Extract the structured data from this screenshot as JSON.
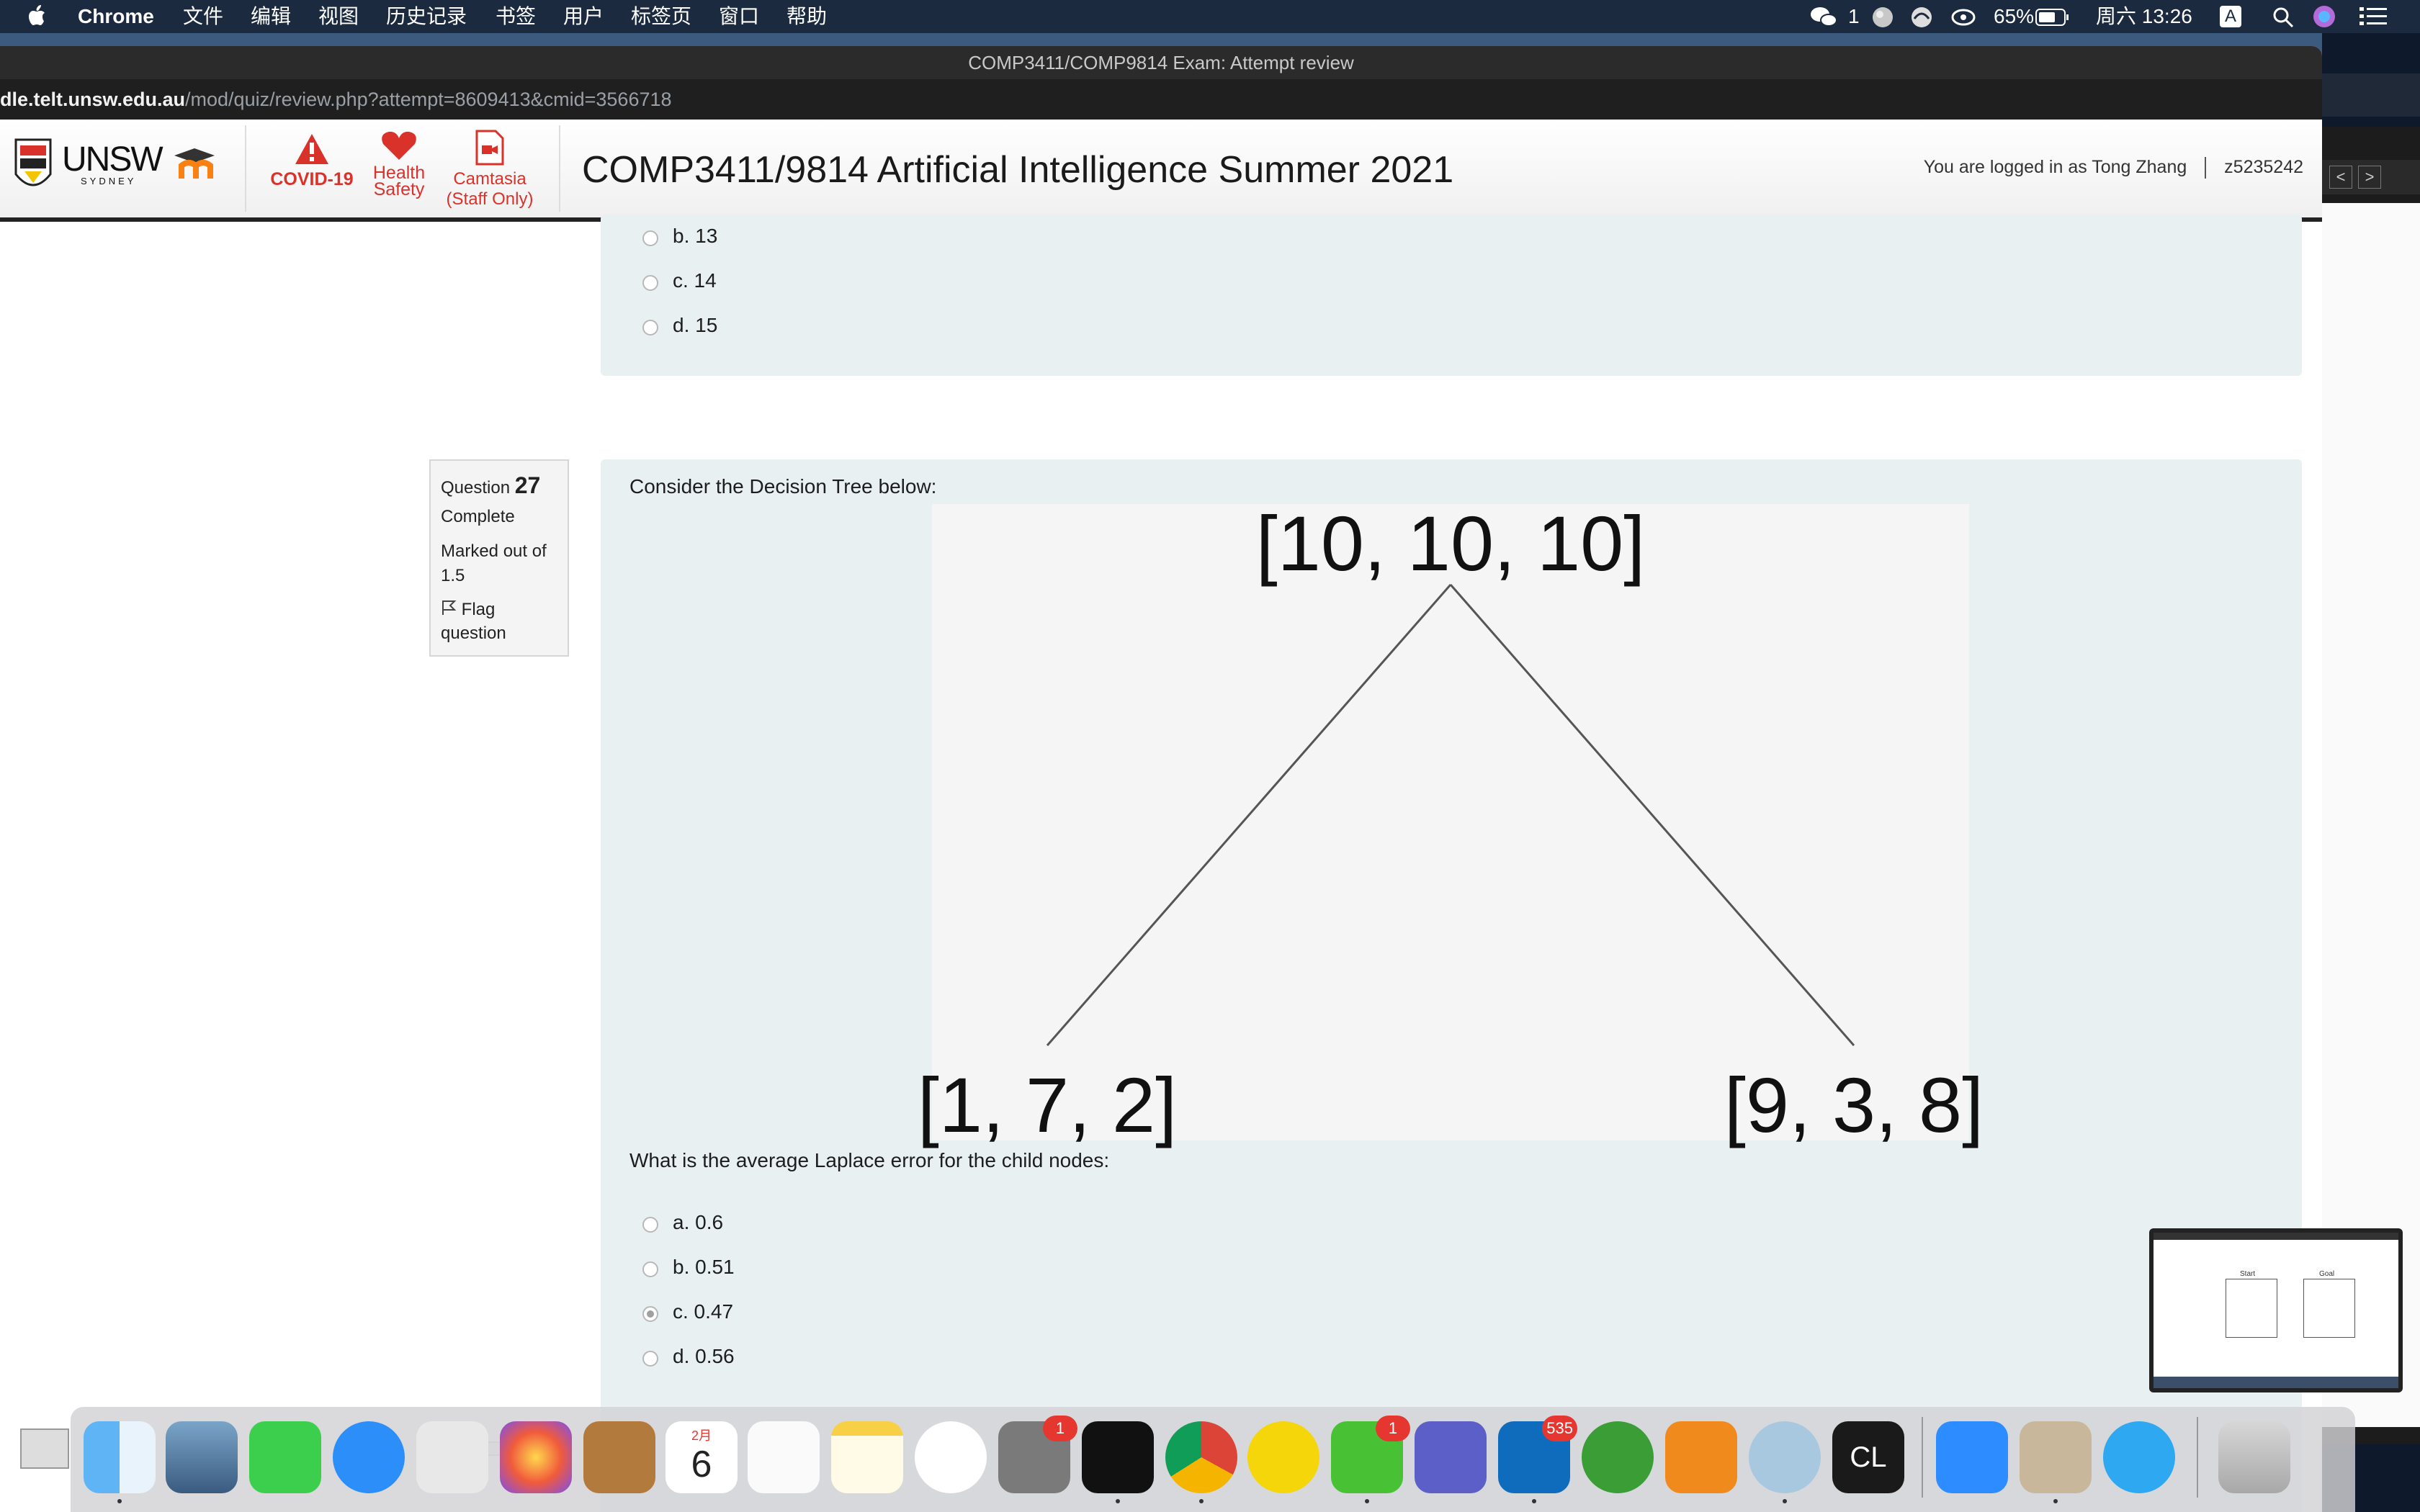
{
  "menubar": {
    "app_name": "Chrome",
    "menus": [
      "文件",
      "编辑",
      "视图",
      "历史记录",
      "书签",
      "用户",
      "标签页",
      "窗口",
      "帮助"
    ],
    "wechat_count": "1",
    "battery": "65%",
    "clock": "周六 13:26",
    "input_method": "A"
  },
  "browser": {
    "window_title": "COMP3411/COMP9814 Exam: Attempt review",
    "url_host": "dle.telt.unsw.edu.au",
    "url_path": "/mod/quiz/review.php?attempt=8609413&cmid=3566718"
  },
  "site_header": {
    "unsw_logo": "UNSW",
    "unsw_sub": "SYDNEY",
    "covid_label": "COVID-19",
    "health_label_1": "Health",
    "health_label_2": "Safety",
    "camtasia_label_1": "Camtasia",
    "camtasia_label_2": "(Staff Only)",
    "course_title": "COMP3411/9814 Artificial Intelligence Summer 2021",
    "login_text": "You are logged in as Tong Zhang",
    "user_id": "z5235242"
  },
  "prev_question": {
    "options": [
      {
        "label": "b. 13",
        "checked": false
      },
      {
        "label": "c. 14",
        "checked": false
      },
      {
        "label": "d. 15",
        "checked": false
      }
    ]
  },
  "question": {
    "label": "Question",
    "number": "27",
    "status": "Complete",
    "marked_out_of_1": "Marked out of",
    "marked_out_of_2": "1.5",
    "flag_1": "Flag",
    "flag_2": "question",
    "prompt": "Consider the Decision Tree below:",
    "tree": {
      "root": "[10, 10, 10]",
      "left": "[1, 7, 2]",
      "right": "[9, 3, 8]"
    },
    "sub_prompt": "What is the average Laplace error for the child nodes:",
    "options": [
      {
        "label": "a. 0.6",
        "checked": false
      },
      {
        "label": "b. 0.51",
        "checked": false
      },
      {
        "label": "c. 0.47",
        "checked": true
      },
      {
        "label": "d. 0.56",
        "checked": false
      }
    ]
  },
  "thumbnail": {
    "start": "Start",
    "goal": "Goal"
  },
  "dock": {
    "calendar_month": "2月",
    "calendar_day": "6",
    "system_prefs_badge": "1",
    "wechat_badge": "1",
    "outlook_badge": "535"
  }
}
